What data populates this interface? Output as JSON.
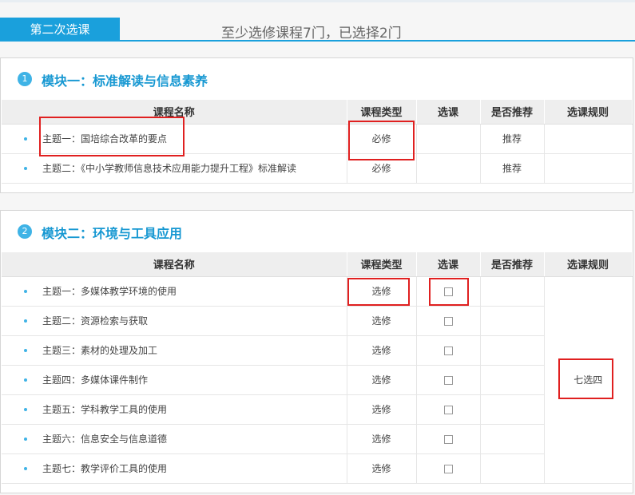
{
  "header": {
    "tab_label": "第二次选课",
    "summary": "至少选修课程7门，已选择2门"
  },
  "columns": {
    "name": "课程名称",
    "type": "课程类型",
    "select": "选课",
    "recommend": "是否推荐",
    "rule": "选课规则"
  },
  "module1": {
    "num": "1",
    "title": "模块一：标准解读与信息素养",
    "rows": [
      {
        "name": "主题一：国培综合改革的要点",
        "type": "必修",
        "recommend": "推荐"
      },
      {
        "name": "主题二：《中小学教师信息技术应用能力提升工程》标准解读",
        "type": "必修",
        "recommend": "推荐"
      }
    ]
  },
  "module2": {
    "num": "2",
    "title": "模块二：环境与工具应用",
    "rule": "七选四",
    "rows": [
      {
        "name": "主题一：多媒体教学环境的使用",
        "type": "选修",
        "checked": false
      },
      {
        "name": "主题二：资源检索与获取",
        "type": "选修",
        "checked": false
      },
      {
        "name": "主题三：素材的处理及加工",
        "type": "选修",
        "checked": false
      },
      {
        "name": "主题四：多媒体课件制作",
        "type": "选修",
        "checked": false
      },
      {
        "name": "主题五：学科教学工具的使用",
        "type": "选修",
        "checked": false
      },
      {
        "name": "主题六：信息安全与信息道德",
        "type": "选修",
        "checked": false
      },
      {
        "name": "主题七：教学评价工具的使用",
        "type": "选修",
        "checked": false
      }
    ]
  },
  "colors": {
    "accent": "#1aa0dc",
    "title": "#1798d2",
    "highlight": "#e02020"
  }
}
